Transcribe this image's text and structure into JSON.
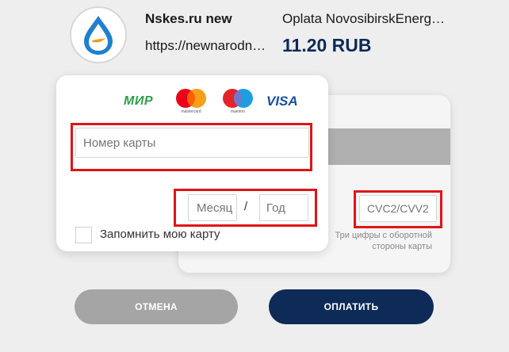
{
  "merchant": {
    "name": "Nskes.ru new",
    "url": "https://newnarodnaya.nskes.ru",
    "logo_icon": "water-drop-logo-icon"
  },
  "order": {
    "description": "Oplata NovosibirskEnergosbyt",
    "amount": "11.20 RUB"
  },
  "card_brands": {
    "mir": "МИР",
    "mastercard_caption": "mastercard",
    "maestro_caption": "maestro",
    "visa": "VISA"
  },
  "form": {
    "card_number_placeholder": "Номер карты",
    "month_placeholder": "Месяц",
    "date_separator": "/",
    "year_placeholder": "Год",
    "cvc_placeholder": "CVC2/CVV2",
    "cvc_hint": "Три цифры с оборотной стороны карты",
    "remember_label": "Запомнить мою карту"
  },
  "buttons": {
    "cancel": "ОТМЕНА",
    "pay": "ОПЛАТИТЬ"
  },
  "colors": {
    "accent_navy": "#0e2a57",
    "highlight_red": "#e01515",
    "cancel_gray": "#a5a5a5",
    "mir_green": "#2da14a",
    "visa_blue": "#1a4fa0"
  }
}
